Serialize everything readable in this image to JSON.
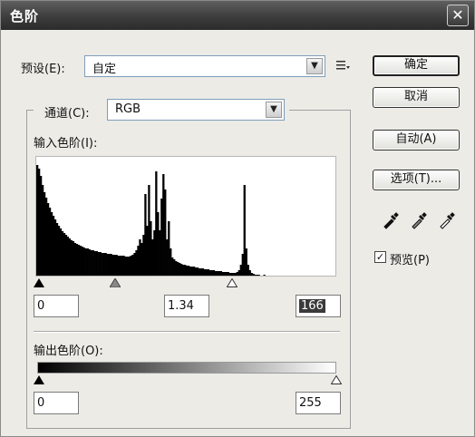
{
  "window": {
    "title": "色阶",
    "close_glyph": "✕"
  },
  "preset": {
    "label": "预设(E):",
    "value": "自定"
  },
  "channel": {
    "label": "通道(C):",
    "value": "RGB"
  },
  "input_levels": {
    "label": "输入色阶(I):",
    "black": "0",
    "gamma": "1.34",
    "white": "166"
  },
  "output_levels": {
    "label": "输出色阶(O):",
    "black": "0",
    "white": "255"
  },
  "buttons": {
    "ok": "确定",
    "cancel": "取消",
    "auto": "自动(A)",
    "options": "选项(T)..."
  },
  "preview": {
    "label": "预览(P)",
    "checked": true
  },
  "icons": {
    "preset_menu": "preset-menu-icon",
    "black_eyedropper": "black-eyedropper-icon",
    "gray_eyedropper": "gray-eyedropper-icon",
    "white_eyedropper": "white-eyedropper-icon"
  },
  "histogram_data": {
    "bins": [
      122,
      118,
      110,
      100,
      92,
      86,
      80,
      75,
      70,
      66,
      62,
      58,
      55,
      52,
      49,
      47,
      45,
      43,
      41,
      39,
      38,
      36,
      35,
      34,
      33,
      32,
      31,
      30,
      30,
      29,
      28,
      28,
      27,
      27,
      26,
      26,
      25,
      25,
      25,
      24,
      24,
      24,
      23,
      23,
      23,
      22,
      22,
      22,
      22,
      21,
      21,
      21,
      22,
      23,
      25,
      28,
      33,
      40,
      36,
      45,
      90,
      55,
      100,
      60,
      40,
      50,
      115,
      70,
      50,
      85,
      112,
      95,
      40,
      60,
      30,
      20,
      18,
      16,
      15,
      14,
      13,
      12,
      12,
      11,
      11,
      10,
      10,
      10,
      9,
      9,
      8,
      8,
      8,
      7,
      7,
      7,
      6,
      6,
      6,
      5,
      5,
      5,
      5,
      4,
      4,
      4,
      4,
      3,
      3,
      3,
      3,
      4,
      6,
      12,
      24,
      100,
      30,
      12,
      6,
      3,
      2,
      1,
      1,
      1,
      0,
      0,
      1,
      0,
      0,
      0,
      0,
      0,
      0,
      0,
      0,
      0,
      0,
      0,
      0,
      0,
      0,
      0,
      0,
      0,
      0,
      0,
      0,
      0,
      0,
      0,
      0,
      0,
      0,
      0,
      0,
      0,
      0,
      0,
      0,
      0,
      0,
      0,
      0,
      0,
      0,
      0
    ]
  }
}
